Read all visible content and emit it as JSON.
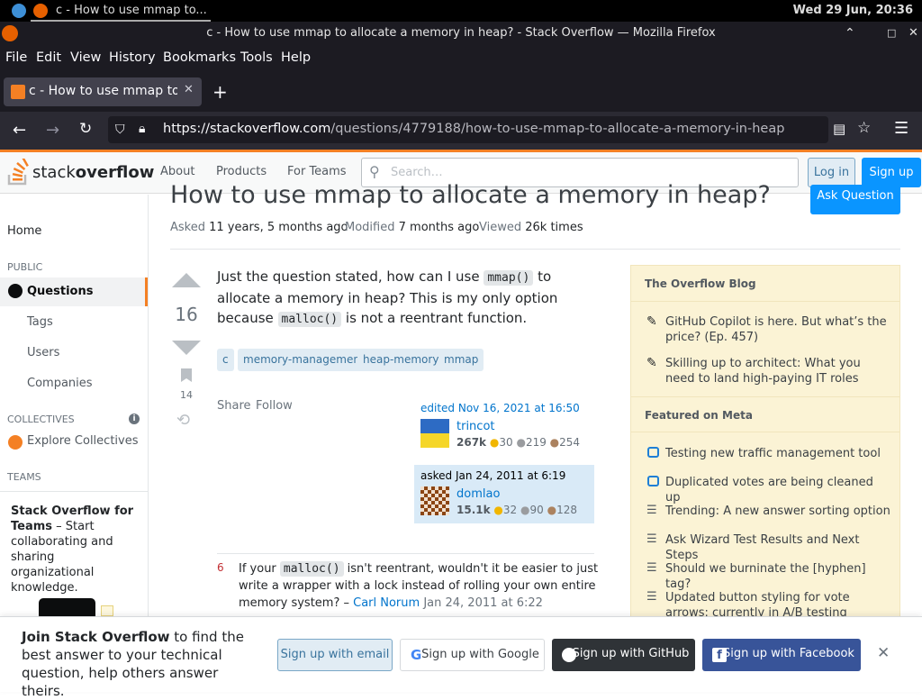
{
  "system": {
    "clock": "Wed 29 Jun, 20:36",
    "task_title": "c - How to use mmap to..."
  },
  "window": {
    "title": "c - How to use mmap to allocate a memory in heap? - Stack Overflow — Mozilla Firefox"
  },
  "menu": [
    "File",
    "Edit",
    "View",
    "History",
    "Bookmarks",
    "Tools",
    "Help"
  ],
  "tab": {
    "title": "c - How to use mmap to a"
  },
  "url": {
    "domain": "https://stackoverflow.com",
    "path": "/questions/4779188/how-to-use-mmap-to-allocate-a-memory-in-heap"
  },
  "so_header": {
    "logo_a": "stack",
    "logo_b": "overflow",
    "about": "About",
    "products": "Products",
    "teams": "For Teams",
    "search_placeholder": "Search…",
    "login": "Log in",
    "signup": "Sign up"
  },
  "leftnav": {
    "home": "Home",
    "public": "PUBLIC",
    "questions": "Questions",
    "tags": "Tags",
    "users": "Users",
    "companies": "Companies",
    "collectives": "COLLECTIVES",
    "explore": "Explore Collectives",
    "teams": "TEAMS",
    "teams_title": "Stack Overflow for Teams",
    "teams_text": " – Start collaborating and sharing organizational knowledge."
  },
  "question": {
    "title": "How to use mmap to allocate a memory in heap?",
    "ask_button": "Ask Question",
    "asked_k": "Asked",
    "asked_v": "11 years, 5 months ago",
    "modified_k": "Modified",
    "modified_v": "7 months ago",
    "viewed_k": "Viewed",
    "viewed_v": "26k times",
    "score": "16",
    "bookmarks": "14",
    "body_1": "Just the question stated, how can I use ",
    "code_1": "mmap()",
    "body_2": " to allocate a memory in heap? This is my only option because ",
    "code_2": "malloc()",
    "body_3": " is not a reentrant function.",
    "tags": [
      "c",
      "memory-management",
      "heap-memory",
      "mmap"
    ],
    "share": "Share",
    "follow": "Follow",
    "edited": "edited Nov 16, 2021 at 16:50",
    "editor": {
      "name": "trincot",
      "rep": "267k",
      "gold": "30",
      "silver": "219",
      "bronze": "254"
    },
    "asked_card": "asked Jan 24, 2011 at 6:19",
    "asker": {
      "name": "domlao",
      "rep": "15.1k",
      "gold": "32",
      "silver": "90",
      "bronze": "128"
    }
  },
  "comment": {
    "score": "6",
    "text_1": "If your ",
    "code": "malloc()",
    "text_2": " isn't reentrant, wouldn't it be easier to just write a wrapper with a lock instead of rolling your own entire memory system? – ",
    "author": "Carl Norum",
    "date": " Jan 24, 2011 at 6:22"
  },
  "sidebar": {
    "blog_title": "The Overflow Blog",
    "blog_items": [
      "GitHub Copilot is here. But what’s the price? (Ep. 457)",
      "Skilling up to architect: What you need to land high-paying IT roles"
    ],
    "meta_title": "Featured on Meta",
    "meta_items": [
      "Testing new traffic management tool",
      "Duplicated votes are being cleaned up",
      "Trending: A new answer sorting option",
      "Ask Wizard Test Results and Next Steps",
      "Should we burninate the [hyphen] tag?",
      "Updated button styling for vote arrows: currently in A/B testing"
    ]
  },
  "banner": {
    "bold": "Join Stack Overflow",
    "text": " to find the best answer to your technical question, help others answer theirs.",
    "email": "Sign up with email",
    "google": "Sign up with Google",
    "github": "Sign up with GitHub",
    "facebook": "Sign up with Facebook"
  }
}
